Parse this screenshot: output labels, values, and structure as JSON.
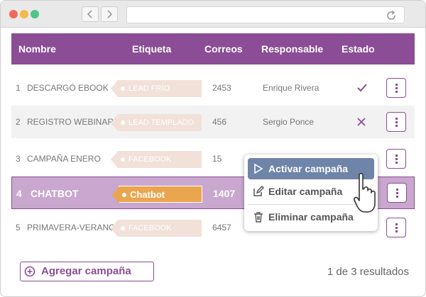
{
  "browser": {
    "back_icon": "chevron-left-icon",
    "forward_icon": "chevron-right-icon",
    "reload_icon": "reload-icon",
    "dot_colors": [
      "#ef6a5a",
      "#f5b94a",
      "#4fc48a"
    ]
  },
  "table": {
    "headers": {
      "name": "Nombre",
      "tag": "Etiqueta",
      "emails": "Correos",
      "owner": "Responsable",
      "status": "Estado"
    },
    "rows": [
      {
        "num": "1",
        "name": "DESCARGÓ EBOOK",
        "tag": "LEAD FRÍO",
        "emails": "2453",
        "owner": "Enrique Rivera",
        "status": "active"
      },
      {
        "num": "2",
        "name": "REGISTRO WEBINAR",
        "tag": "LEAD TEMPLADO",
        "emails": "456",
        "owner": "Sergio Ponce",
        "status": "inactive"
      },
      {
        "num": "3",
        "name": "CAMPAÑA ENERO",
        "tag": "FACEBOOK",
        "emails": "15",
        "owner": "",
        "status": ""
      },
      {
        "num": "4",
        "name": "CHATBOT",
        "tag": "Chatbot",
        "emails": "1407",
        "owner": "",
        "status": "",
        "selected": true
      },
      {
        "num": "5",
        "name": "PRIMAVERA-VERANO",
        "tag": "FACEBOOK",
        "emails": "6457",
        "owner": "",
        "status": ""
      }
    ]
  },
  "context_menu": {
    "activate": "Activar campaña",
    "edit": "Editar campaña",
    "delete": "Eliminar campaña"
  },
  "footer": {
    "add_campaign": "Agregar campaña",
    "results": "1 de 3 resultados"
  },
  "colors": {
    "accent": "#8b4d95",
    "selected_row": "#c9a7cf",
    "tag": "#f1e1d9",
    "tag_active": "#e9a64f",
    "menu_highlight": "#6e84a8"
  }
}
